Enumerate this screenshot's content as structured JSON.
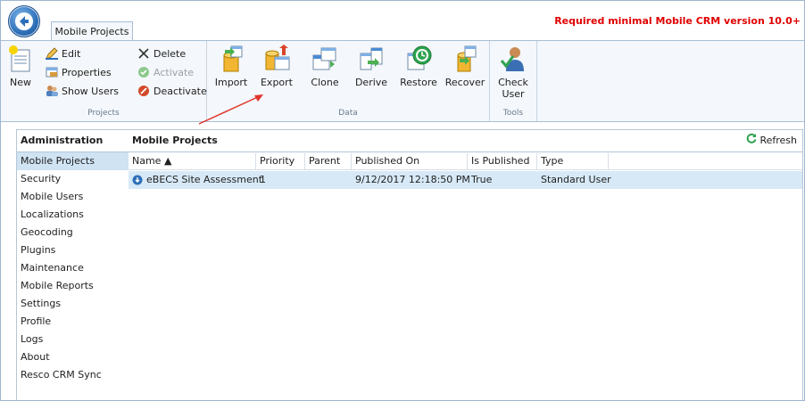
{
  "app": {
    "tab_label": "Mobile Projects",
    "requirement_note": "Required minimal Mobile CRM version 10.0+"
  },
  "ribbon": {
    "projects_group": {
      "label": "Projects",
      "new_label": "New",
      "edit_label": "Edit",
      "properties_label": "Properties",
      "show_users_label": "Show Users",
      "delete_label": "Delete",
      "activate_label": "Activate",
      "deactivate_label": "Deactivate"
    },
    "data_group": {
      "label": "Data",
      "import_label": "Import",
      "export_label": "Export",
      "clone_label": "Clone",
      "derive_label": "Derive",
      "restore_label": "Restore",
      "recover_label": "Recover"
    },
    "tools_group": {
      "label": "Tools",
      "check_user_line1": "Check",
      "check_user_line2": "User"
    }
  },
  "sidebar": {
    "title": "Administration",
    "items": [
      {
        "label": "Mobile Projects",
        "selected": true
      },
      {
        "label": "Security"
      },
      {
        "label": "Mobile Users"
      },
      {
        "label": "Localizations"
      },
      {
        "label": "Geocoding"
      },
      {
        "label": "Plugins"
      },
      {
        "label": "Maintenance"
      },
      {
        "label": "Mobile Reports"
      },
      {
        "label": "Settings"
      },
      {
        "label": "Profile"
      },
      {
        "label": "Logs"
      },
      {
        "label": "About"
      },
      {
        "label": "Resco CRM Sync"
      }
    ]
  },
  "main": {
    "title": "Mobile Projects",
    "refresh_label": "Refresh",
    "columns": [
      "Name ▲",
      "Priority",
      "Parent",
      "Published On",
      "Is Published",
      "Type"
    ],
    "rows": [
      {
        "name": "eBECS Site Assessment",
        "priority": "1",
        "parent": "",
        "published_on": "9/12/2017 12:18:50 PM",
        "is_published": "True",
        "type": "Standard User"
      }
    ]
  },
  "colors": {
    "accent": "#2c6fb8",
    "warning": "#e00000",
    "selection": "#d7e9f7"
  }
}
